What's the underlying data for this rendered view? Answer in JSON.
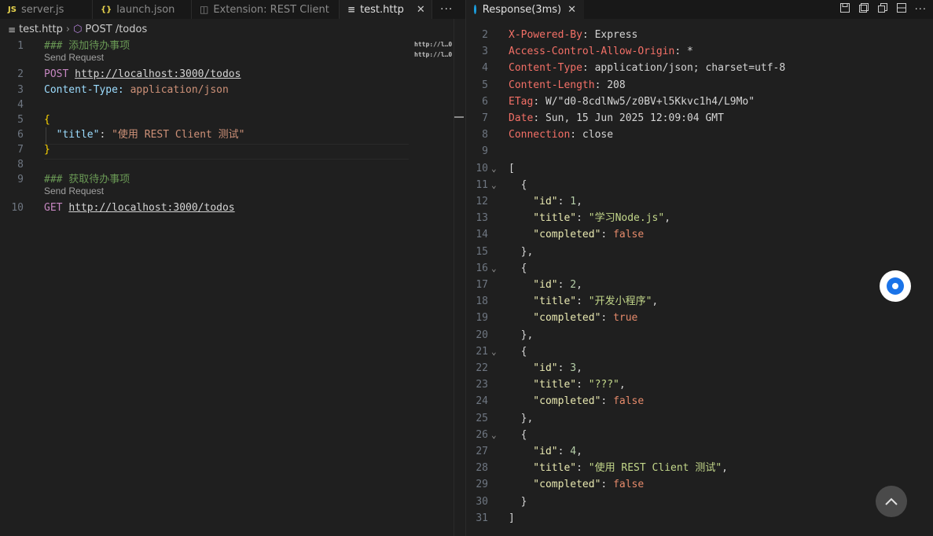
{
  "tabs": [
    {
      "icon": "JS",
      "label": "server.js"
    },
    {
      "icon": "{}",
      "label": "launch.json"
    },
    {
      "icon": "◫",
      "label": "Extension: REST Client"
    },
    {
      "icon": "≡",
      "label": "test.http"
    }
  ],
  "response_tab": {
    "label": "Response(3ms)"
  },
  "breadcrumb": {
    "file": "test.http",
    "symbol": "POST /todos"
  },
  "editor": {
    "lines": [
      {
        "n": "1",
        "parts": [
          {
            "c": "kw-comment",
            "t": "### 添加待办事项"
          }
        ]
      },
      {
        "n": "2",
        "parts": [
          {
            "c": "kw-method",
            "t": "POST "
          },
          {
            "c": "kw-url",
            "t": "http://localhost:3000/todos"
          }
        ]
      },
      {
        "n": "3",
        "parts": [
          {
            "c": "kw-hname",
            "t": "Content-Type: "
          },
          {
            "c": "kw-hval",
            "t": "application/json"
          }
        ]
      },
      {
        "n": "4",
        "parts": []
      },
      {
        "n": "5",
        "parts": [
          {
            "c": "brace",
            "t": "{"
          }
        ]
      },
      {
        "n": "6",
        "parts": [
          {
            "c": "jkey",
            "t": "  \"title\""
          },
          {
            "c": "rval",
            "t": ": "
          },
          {
            "c": "jstr",
            "t": "\"使用 REST Client 测试\""
          }
        ]
      },
      {
        "n": "7",
        "parts": [
          {
            "c": "brace",
            "t": "}"
          }
        ]
      },
      {
        "n": "8",
        "parts": []
      },
      {
        "n": "9",
        "parts": [
          {
            "c": "kw-comment",
            "t": "### 获取待办事项"
          }
        ]
      },
      {
        "n": "10",
        "parts": [
          {
            "c": "kw-method",
            "t": "GET "
          },
          {
            "c": "kw-url",
            "t": "http://localhost:3000/todos"
          }
        ]
      }
    ],
    "send_request_label": "Send Request",
    "minimap": [
      "http://l…0",
      "http://l…0"
    ]
  },
  "response": {
    "lines": [
      {
        "n": "2",
        "parts": [
          {
            "c": "rkey",
            "t": "X-Powered-By"
          },
          {
            "c": "rval",
            "t": ": Express"
          }
        ]
      },
      {
        "n": "3",
        "parts": [
          {
            "c": "rkey",
            "t": "Access-Control-Allow-Origin"
          },
          {
            "c": "rval",
            "t": ": *"
          }
        ]
      },
      {
        "n": "4",
        "parts": [
          {
            "c": "rkey",
            "t": "Content-Type"
          },
          {
            "c": "rval",
            "t": ": application/json; charset=utf-8"
          }
        ]
      },
      {
        "n": "5",
        "parts": [
          {
            "c": "rkey",
            "t": "Content-Length"
          },
          {
            "c": "rval",
            "t": ": 208"
          }
        ]
      },
      {
        "n": "6",
        "parts": [
          {
            "c": "rkey",
            "t": "ETag"
          },
          {
            "c": "rval",
            "t": ": W/\"d0-8cdlNw5/z0BV+l5Kkvc1h4/L9Mo\""
          }
        ]
      },
      {
        "n": "7",
        "parts": [
          {
            "c": "rkey",
            "t": "Date"
          },
          {
            "c": "rval",
            "t": ": Sun, 15 Jun 2025 12:09:04 GMT"
          }
        ]
      },
      {
        "n": "8",
        "parts": [
          {
            "c": "rkey",
            "t": "Connection"
          },
          {
            "c": "rval",
            "t": ": close"
          }
        ]
      },
      {
        "n": "9",
        "parts": []
      },
      {
        "n": "10",
        "fold": true,
        "parts": [
          {
            "c": "rval",
            "t": "["
          }
        ]
      },
      {
        "n": "11",
        "fold": true,
        "parts": [
          {
            "c": "rval",
            "t": "  {"
          }
        ]
      },
      {
        "n": "12",
        "parts": [
          {
            "c": "rjkey",
            "t": "    \"id\""
          },
          {
            "c": "rval",
            "t": ": "
          },
          {
            "c": "rjnum",
            "t": "1"
          },
          {
            "c": "rval",
            "t": ","
          }
        ]
      },
      {
        "n": "13",
        "parts": [
          {
            "c": "rjkey",
            "t": "    \"title\""
          },
          {
            "c": "rval",
            "t": ": "
          },
          {
            "c": "rjstr",
            "t": "\"学习Node.js\""
          },
          {
            "c": "rval",
            "t": ","
          }
        ]
      },
      {
        "n": "14",
        "parts": [
          {
            "c": "rjkey",
            "t": "    \"completed\""
          },
          {
            "c": "rval",
            "t": ": "
          },
          {
            "c": "rjbool",
            "t": "false"
          }
        ]
      },
      {
        "n": "15",
        "parts": [
          {
            "c": "rval",
            "t": "  },"
          }
        ]
      },
      {
        "n": "16",
        "fold": true,
        "parts": [
          {
            "c": "rval",
            "t": "  {"
          }
        ]
      },
      {
        "n": "17",
        "parts": [
          {
            "c": "rjkey",
            "t": "    \"id\""
          },
          {
            "c": "rval",
            "t": ": "
          },
          {
            "c": "rjnum",
            "t": "2"
          },
          {
            "c": "rval",
            "t": ","
          }
        ]
      },
      {
        "n": "18",
        "parts": [
          {
            "c": "rjkey",
            "t": "    \"title\""
          },
          {
            "c": "rval",
            "t": ": "
          },
          {
            "c": "rjstr",
            "t": "\"开发小程序\""
          },
          {
            "c": "rval",
            "t": ","
          }
        ]
      },
      {
        "n": "19",
        "parts": [
          {
            "c": "rjkey",
            "t": "    \"completed\""
          },
          {
            "c": "rval",
            "t": ": "
          },
          {
            "c": "rjbool",
            "t": "true"
          }
        ]
      },
      {
        "n": "20",
        "parts": [
          {
            "c": "rval",
            "t": "  },"
          }
        ]
      },
      {
        "n": "21",
        "fold": true,
        "parts": [
          {
            "c": "rval",
            "t": "  {"
          }
        ]
      },
      {
        "n": "22",
        "parts": [
          {
            "c": "rjkey",
            "t": "    \"id\""
          },
          {
            "c": "rval",
            "t": ": "
          },
          {
            "c": "rjnum",
            "t": "3"
          },
          {
            "c": "rval",
            "t": ","
          }
        ]
      },
      {
        "n": "23",
        "parts": [
          {
            "c": "rjkey",
            "t": "    \"title\""
          },
          {
            "c": "rval",
            "t": ": "
          },
          {
            "c": "rjstr",
            "t": "\"???\""
          },
          {
            "c": "rval",
            "t": ","
          }
        ]
      },
      {
        "n": "24",
        "parts": [
          {
            "c": "rjkey",
            "t": "    \"completed\""
          },
          {
            "c": "rval",
            "t": ": "
          },
          {
            "c": "rjbool",
            "t": "false"
          }
        ]
      },
      {
        "n": "25",
        "parts": [
          {
            "c": "rval",
            "t": "  },"
          }
        ]
      },
      {
        "n": "26",
        "fold": true,
        "parts": [
          {
            "c": "rval",
            "t": "  {"
          }
        ]
      },
      {
        "n": "27",
        "parts": [
          {
            "c": "rjkey",
            "t": "    \"id\""
          },
          {
            "c": "rval",
            "t": ": "
          },
          {
            "c": "rjnum",
            "t": "4"
          },
          {
            "c": "rval",
            "t": ","
          }
        ]
      },
      {
        "n": "28",
        "parts": [
          {
            "c": "rjkey",
            "t": "    \"title\""
          },
          {
            "c": "rval",
            "t": ": "
          },
          {
            "c": "rjstr",
            "t": "\"使用 REST Client 测试\""
          },
          {
            "c": "rval",
            "t": ","
          }
        ]
      },
      {
        "n": "29",
        "parts": [
          {
            "c": "rjkey",
            "t": "    \"completed\""
          },
          {
            "c": "rval",
            "t": ": "
          },
          {
            "c": "rjbool",
            "t": "false"
          }
        ]
      },
      {
        "n": "30",
        "parts": [
          {
            "c": "rval",
            "t": "  }"
          }
        ]
      },
      {
        "n": "31",
        "parts": [
          {
            "c": "rval",
            "t": "]"
          }
        ]
      }
    ]
  },
  "icons": {
    "save": "save-icon",
    "copy": "copy-icon",
    "split": "split-editor-icon",
    "more": "more-icon",
    "float": "assistant-icon",
    "scroll_top": "chevron-up-icon"
  }
}
